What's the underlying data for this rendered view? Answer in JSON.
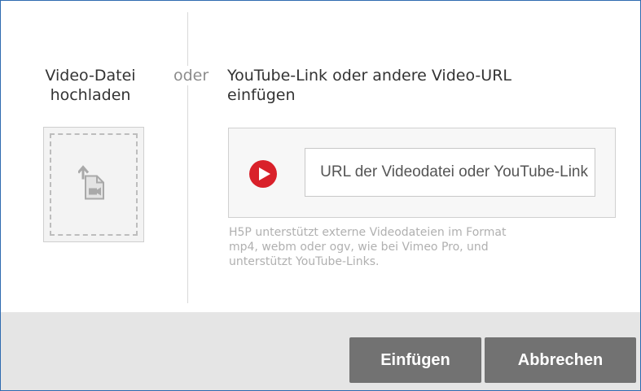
{
  "upload": {
    "title_line1": "Video-Datei",
    "title_line2": "hochladen",
    "icon": "file-upload-video-icon"
  },
  "divider": {
    "or_label": "oder"
  },
  "url_section": {
    "title_line1": "YouTube-Link oder andere Video-URL",
    "title_line2": "einfügen",
    "play_icon": "play-icon",
    "input_placeholder": "URL der Videodatei oder YouTube-Link",
    "input_value": "",
    "help_text": "H5P unterstützt externe Videodateien im Format\nmp4, webm oder ogv, wie bei Vimeo Pro, und\nunterstützt YouTube-Links."
  },
  "footer": {
    "insert_label": "Einfügen",
    "cancel_label": "Abbrechen"
  },
  "colors": {
    "play": "#d9212a",
    "button_bg": "#727272",
    "footer_bg": "#e5e5e5",
    "border": "#2f6bb0"
  }
}
